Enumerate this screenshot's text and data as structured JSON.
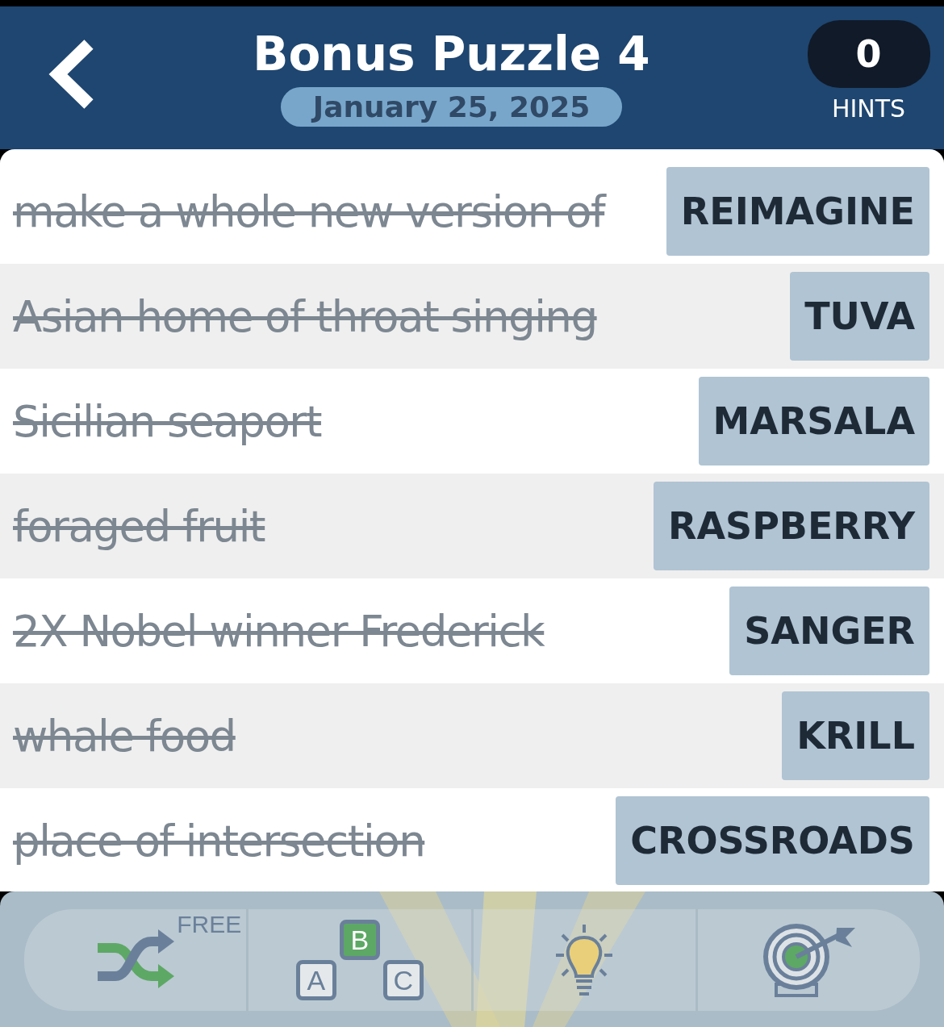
{
  "header": {
    "title": "Bonus Puzzle 4",
    "date": "January 25, 2025",
    "hints": {
      "count": "0",
      "label": "HINTS"
    }
  },
  "clues": [
    {
      "clue": "make a whole new version of",
      "answer": "REIMAGINE",
      "solved": true
    },
    {
      "clue": "Asian home of throat singing",
      "answer": "TUVA",
      "solved": true
    },
    {
      "clue": "Sicilian seaport",
      "answer": "MARSALA",
      "solved": true
    },
    {
      "clue": "foraged fruit",
      "answer": "RASPBERRY",
      "solved": true
    },
    {
      "clue": "2X Nobel winner Frederick",
      "answer": "SANGER",
      "solved": true
    },
    {
      "clue": "whale food",
      "answer": "KRILL",
      "solved": true
    },
    {
      "clue": "place of intersection",
      "answer": "CROSSROADS",
      "solved": true
    }
  ],
  "toolbar": [
    {
      "kind": "shuffle",
      "badge": "FREE"
    },
    {
      "kind": "letters",
      "letters": [
        "A",
        "B",
        "C"
      ]
    },
    {
      "kind": "hint"
    },
    {
      "kind": "target"
    }
  ]
}
